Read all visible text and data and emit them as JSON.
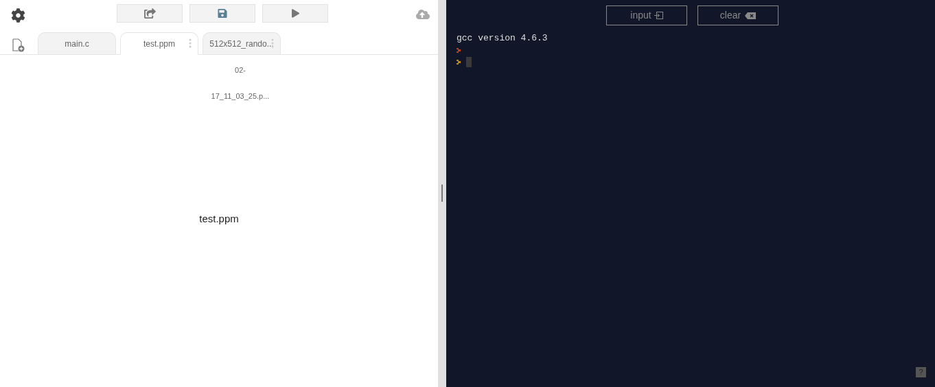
{
  "toolbar": {
    "buttons": [
      {
        "kind": "share"
      },
      {
        "kind": "save"
      },
      {
        "kind": "run"
      }
    ]
  },
  "tabs": [
    {
      "label": "main.c",
      "selected": false,
      "menu": false
    },
    {
      "label": "test.ppm",
      "selected": true,
      "menu": true
    },
    {
      "label": "512x512_rando...",
      "selected": false,
      "menu": true
    }
  ],
  "viewer": {
    "alt_lines": [
      "02-",
      "17_11_03_25.p..."
    ],
    "file_name": "test.ppm"
  },
  "console": {
    "buttons": [
      {
        "label": "input",
        "kind": "input"
      },
      {
        "label": "clear",
        "kind": "clear"
      }
    ],
    "output": "gcc version 4.6.3",
    "prompts": [
      {
        "color": "#c2410c",
        "cursor": false
      },
      {
        "color": "#ca8a04",
        "cursor": true
      }
    ],
    "help": "?"
  }
}
